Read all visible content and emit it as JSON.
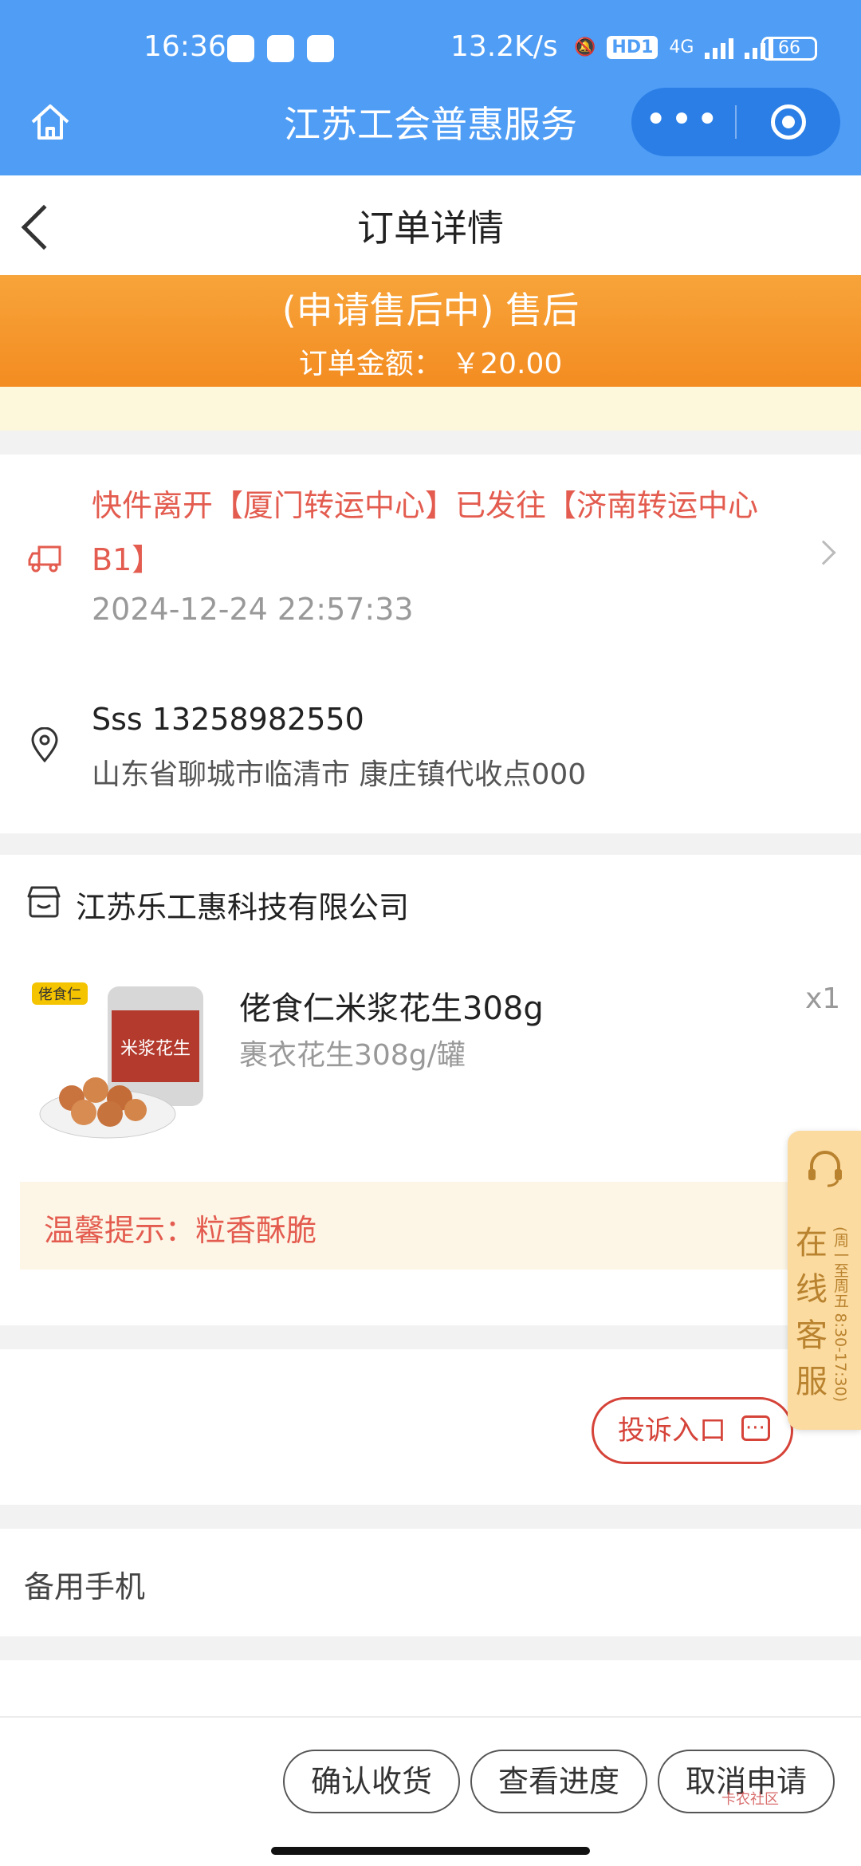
{
  "status_bar": {
    "time": "16:36",
    "network_speed": "13.2K/s",
    "hd_label": "HD1",
    "signal_label": "4G",
    "battery": "66"
  },
  "mini_program": {
    "title": "江苏工会普惠服务",
    "more_label": "•••"
  },
  "page": {
    "title": "订单详情"
  },
  "order_status": {
    "status": "(申请售后中) 售后",
    "amount_label": "订单金额：",
    "amount": "￥20.00"
  },
  "logistics": {
    "latest": "快件离开【厦门转运中心】已发往【济南转运中心B1】",
    "time": "2024-12-24 22:57:33"
  },
  "address": {
    "name_phone": "Sss 13258982550",
    "detail": "山东省聊城市临清市 康庄镇代收点000"
  },
  "shop": {
    "name": "江苏乐工惠科技有限公司"
  },
  "product": {
    "name": "佬食仁米浆花生308g",
    "spec": "裹衣花生308g/罐",
    "qty": "x1",
    "image_brand_text": "佬食仁",
    "image_label_text": "米浆花生"
  },
  "tip": {
    "text": "温馨提示：粒香酥脆"
  },
  "complain": {
    "label": "投诉入口"
  },
  "backup_phone": {
    "label": "备用手机"
  },
  "customer_service": {
    "label": "在线客服",
    "hours": "(周一至周五 8:30-17:30)"
  },
  "actions": {
    "confirm_receipt": "确认收货",
    "view_progress": "查看进度",
    "cancel_request": "取消申请"
  },
  "watermark": "卡农社区",
  "colors": {
    "nav_blue": "#4f9df5",
    "status_orange": "#f38c21",
    "alert_red": "#e35c4f"
  }
}
